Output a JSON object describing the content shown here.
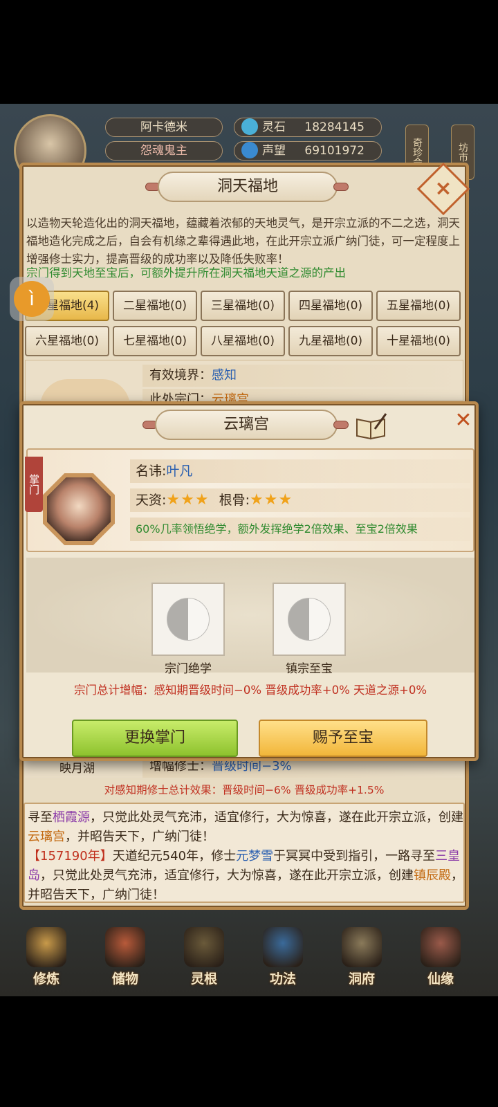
{
  "player": {
    "name": "阿卡德米",
    "title": "怨魂鬼主",
    "resources": [
      {
        "name": "灵石",
        "value": "18284145",
        "icon": "spirit-stone-icon"
      },
      {
        "name": "声望",
        "value": "69101972",
        "icon": "prestige-icon"
      }
    ],
    "side_tags": [
      "奇珍会",
      "坊市"
    ]
  },
  "main_panel": {
    "title": "洞天福地",
    "description": "以造物天轮造化出的洞天福地，蕴藏着浓郁的天地灵气，是开宗立派的不二之选，洞天福地造化完成之后，自会有机缘之辈得遇此地，在此开宗立派广纳门徒，可一定程度上增强修士实力，提高晋级的成功率以及降低失败率！",
    "description_green": "宗门得到天地至宝后，可额外提升所在洞天福地天道之源的产出",
    "grades": [
      {
        "label": "一星福地(4)",
        "active": true
      },
      {
        "label": "二星福地(0)"
      },
      {
        "label": "三星福地(0)"
      },
      {
        "label": "四星福地(0)"
      },
      {
        "label": "五星福地(0)"
      },
      {
        "label": "六星福地(0)"
      },
      {
        "label": "七星福地(0)"
      },
      {
        "label": "八星福地(0)"
      },
      {
        "label": "九星福地(0)"
      },
      {
        "label": "十星福地(0)"
      }
    ],
    "realm_label": "有效境界：",
    "realm_value": "感知",
    "location_label": "此处宗门：",
    "location_value": "云璃宫",
    "site_name": "映月湖",
    "boost_label": "增幅修士：",
    "boost_value": "晋级时间−3%",
    "total_effect": "对感知期修士总计效果：晋级时间−6% 晋级成功率+1.5%",
    "log": [
      {
        "parts": [
          {
            "t": "寻至"
          },
          {
            "t": "栖霞源",
            "c": "hl-purple"
          },
          {
            "t": "，只觉此处灵气充沛，适宜修行，大为惊喜，遂在此开宗立派，创建"
          },
          {
            "t": "云璃宫",
            "c": "hl-orange"
          },
          {
            "t": "，并昭告天下，广纳门徒！"
          }
        ]
      },
      {
        "parts": [
          {
            "t": "【157190年】",
            "c": "hl-red"
          },
          {
            "t": "天道纪元540年，修士"
          },
          {
            "t": "元梦雪",
            "c": "hl-blue"
          },
          {
            "t": "于冥冥中受到指引，一路寻至"
          },
          {
            "t": "三皇岛",
            "c": "hl-purple"
          },
          {
            "t": "，只觉此处灵气充沛，适宜修行，大为惊喜，遂在此开宗立派，创建"
          },
          {
            "t": "镇辰殿",
            "c": "hl-orange"
          },
          {
            "t": "，并昭告天下，广纳门徒！"
          }
        ]
      }
    ]
  },
  "sect_dialog": {
    "title": "云璃宫",
    "leader_tag": "掌门",
    "name_label": "名讳:",
    "name_value": "叶凡",
    "aptitude_label": "天资:",
    "aptitude_stars": "★★★",
    "root_label": "根骨:",
    "root_stars": "★★★",
    "trait": "60%几率领悟绝学，额外发挥绝学2倍效果、至宝2倍效果",
    "slots": [
      {
        "label": "宗门绝学",
        "icon": "yin-yang-icon"
      },
      {
        "label": "镇宗至宝",
        "icon": "yin-yang-icon"
      }
    ],
    "bonus": "宗门总计增幅：感知期晋级时间−0% 晋级成功率+0% 天道之源+0%",
    "change_leader_label": "更换掌门",
    "grant_treasure_label": "赐予至宝",
    "close_icon": "close-icon"
  },
  "bottom_nav": [
    {
      "label": "修炼",
      "color": "#c89a4a"
    },
    {
      "label": "储物",
      "color": "#b85a3a"
    },
    {
      "label": "灵根",
      "color": "#6a5a3a"
    },
    {
      "label": "功法",
      "color": "#3a6a9a"
    },
    {
      "label": "洞府",
      "color": "#8a7a5a"
    },
    {
      "label": "仙缘",
      "color": "#9a5a4a"
    }
  ],
  "colors": {
    "panel_border": "#b98a4e",
    "accent_red": "#c03020",
    "accent_green": "#2f8a2f",
    "star": "#f0a21a"
  }
}
